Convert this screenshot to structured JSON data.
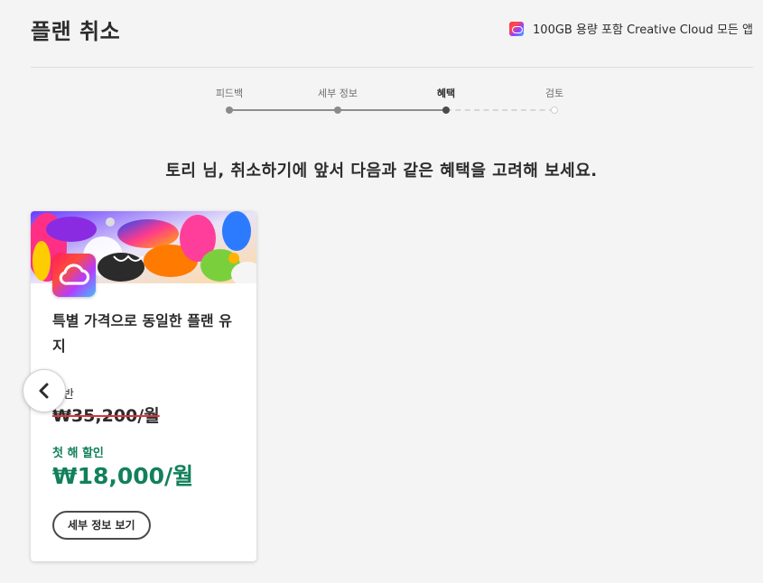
{
  "header": {
    "title": "플랜 취소",
    "plan_name": "100GB 용량 포함 Creative Cloud 모든 앱"
  },
  "stepper": {
    "steps": [
      {
        "label": "피드백",
        "state": "done"
      },
      {
        "label": "세부 정보",
        "state": "done"
      },
      {
        "label": "혜택",
        "state": "current"
      },
      {
        "label": "검토",
        "state": "upcoming"
      }
    ]
  },
  "headline": "토리 님, 취소하기에 앞서 다음과 같은 혜택을 고려해 보세요.",
  "offer_card": {
    "title": "특별 가격으로 동일한 플랜 유지",
    "regular_label": "일반",
    "regular_price": "₩35,200/월",
    "discount_label": "첫 해 할인",
    "discount_price": "₩18,000/월",
    "details_button": "세부 정보 보기",
    "app_icon": "creative-cloud-icon"
  },
  "carousel": {
    "prev_icon": "chevron-left-icon"
  },
  "colors": {
    "background": "#f4f4f4",
    "discount_green": "#12805c",
    "strike_red": "#d7373f",
    "text": "#2c2c2c"
  }
}
